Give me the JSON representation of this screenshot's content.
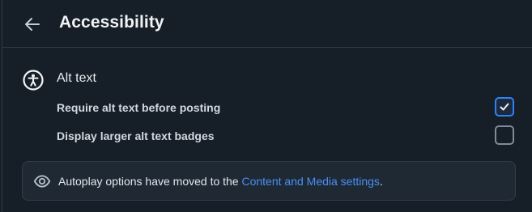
{
  "header": {
    "back_icon": "arrow-left-icon",
    "title": "Accessibility"
  },
  "section": {
    "icon": "accessibility-icon",
    "title": "Alt text"
  },
  "settings": [
    {
      "label": "Require alt text before posting",
      "checked": true
    },
    {
      "label": "Display larger alt text badges",
      "checked": false
    }
  ],
  "notice": {
    "icon": "eye-icon",
    "text_before": "Autoplay options have moved to the ",
    "link_text": "Content and Media settings",
    "text_after": "."
  },
  "colors": {
    "background": "#161e27",
    "accent": "#2f81f7",
    "link": "#4a90f3"
  }
}
